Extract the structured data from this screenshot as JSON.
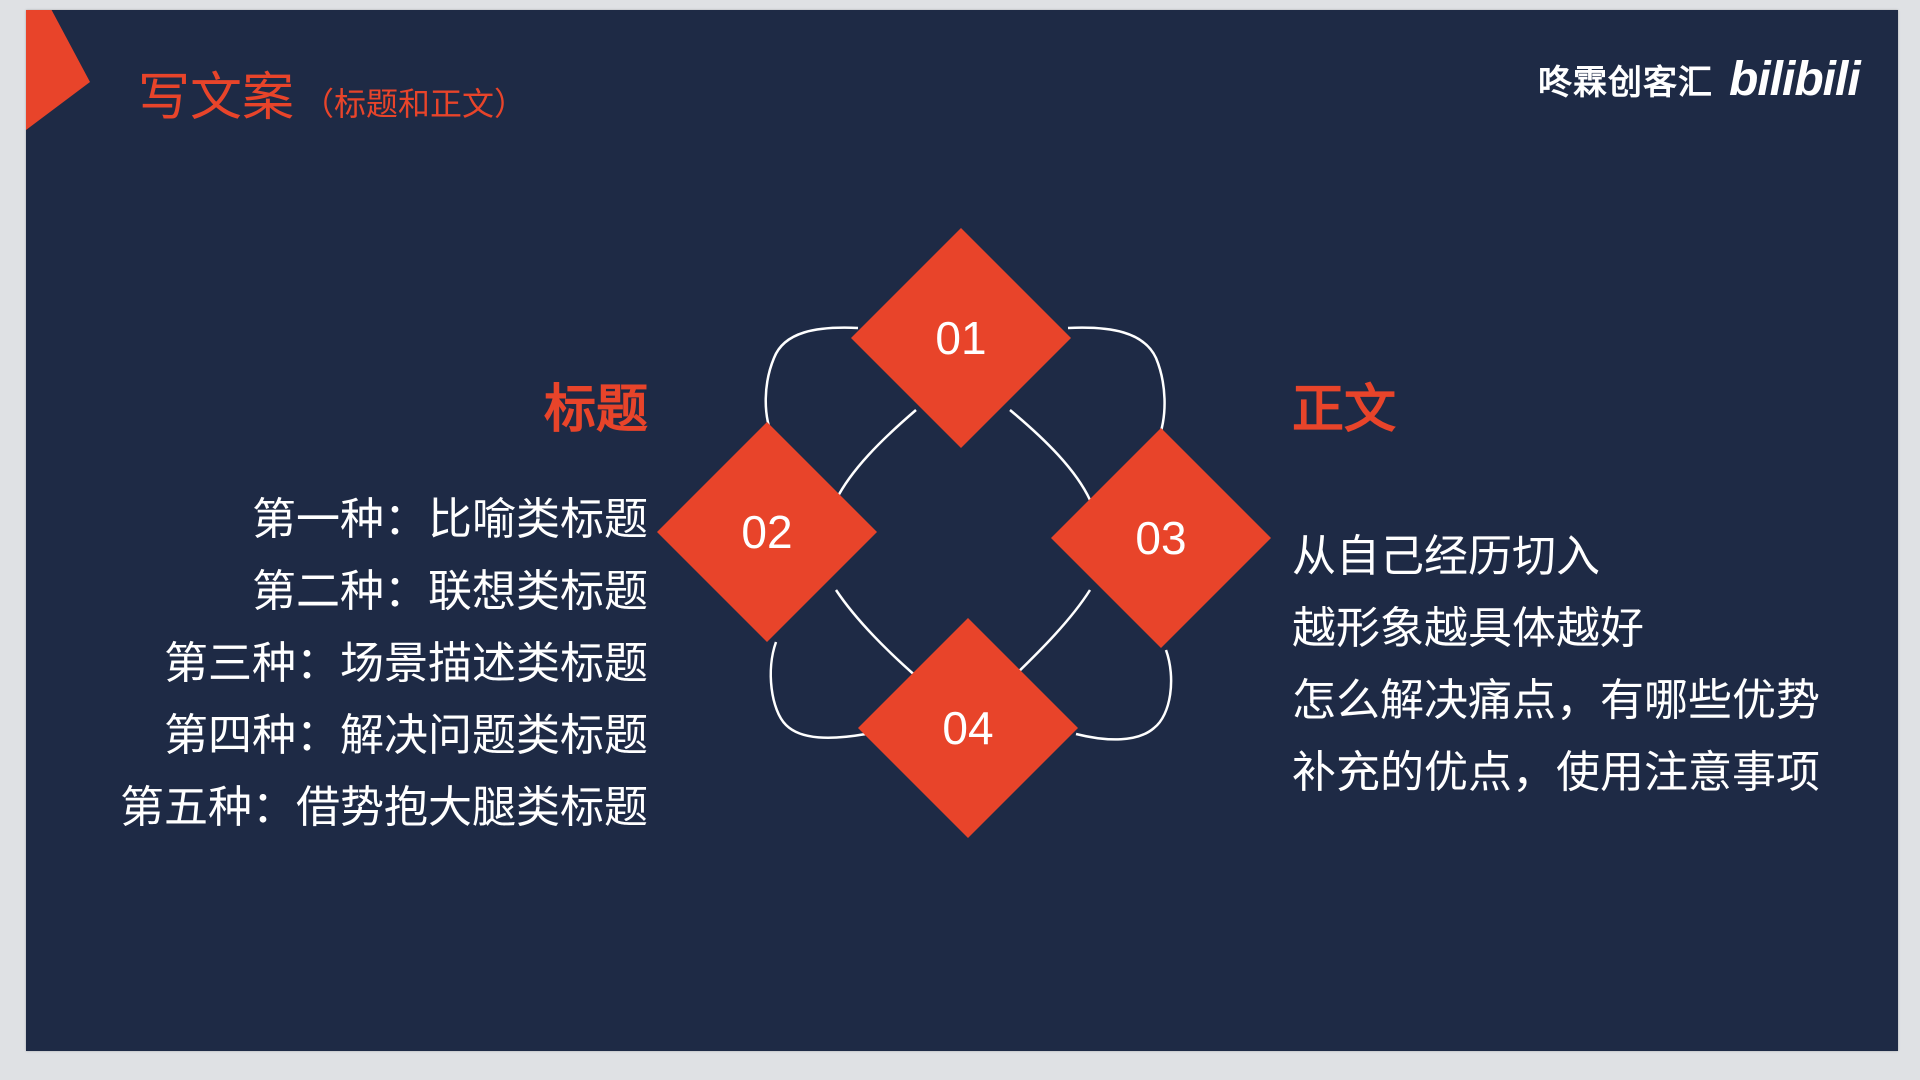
{
  "header": {
    "title": "写文案",
    "subtitle": "（标题和正文）"
  },
  "brand": {
    "name": "咚霖创客汇",
    "logo_text": "bilibili"
  },
  "left": {
    "heading": "标题",
    "items": [
      "第一种：比喻类标题",
      "第二种：联想类标题",
      "第三种：场景描述类标题",
      "第四种：解决问题类标题",
      "第五种：借势抱大腿类标题"
    ]
  },
  "right": {
    "heading": "正文",
    "items": [
      "从自己经历切入",
      "越形象越具体越好",
      "怎么解决痛点，有哪些优势",
      "补充的优点，使用注意事项"
    ]
  },
  "diagram": {
    "labels": [
      "01",
      "02",
      "03",
      "04"
    ]
  },
  "colors": {
    "background": "#1e2a45",
    "accent": "#e8442a",
    "text": "#ffffff"
  }
}
